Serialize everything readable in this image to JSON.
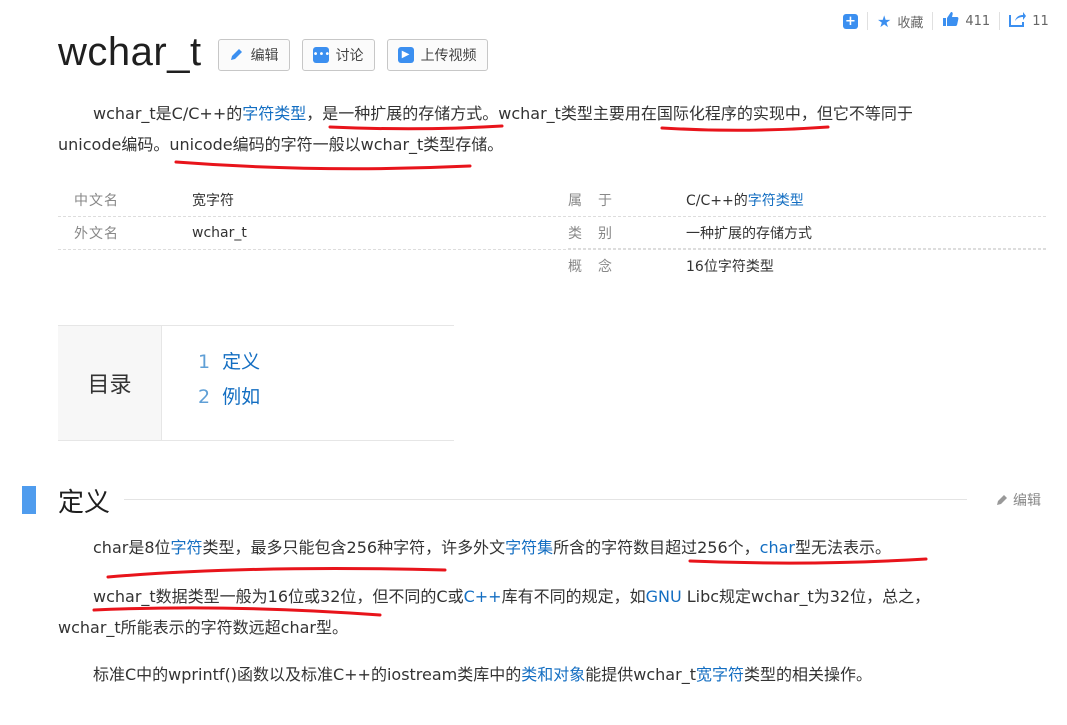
{
  "toolbar": {
    "favorite_label": "收藏",
    "like_count": "411",
    "share_count_partial": "11"
  },
  "title": "wchar_t",
  "buttons": {
    "edit": "编辑",
    "discuss": "讨论",
    "upload_video": "上传视频"
  },
  "summary": {
    "t1": "wchar_t是C/C++的",
    "link1": "字符类型",
    "t2": "，是一种扩展的存储方式。wchar_t类型主要用在国际化程序的实现中，但它不等同于",
    "line2": "unicode编码。unicode编码的字符一般以wchar_t类型存储。"
  },
  "info": {
    "left": [
      {
        "label": "中文名",
        "value": "宽字符"
      },
      {
        "label": "外文名",
        "value": "wchar_t"
      }
    ],
    "right": [
      {
        "label": "属　于",
        "value_prefix": "C/C++的",
        "value_link": "字符类型"
      },
      {
        "label": "类　别",
        "value": "一种扩展的存储方式"
      },
      {
        "label": "概　念",
        "value": "16位字符类型"
      }
    ]
  },
  "catalog": {
    "title": "目录",
    "items": [
      {
        "num": "1",
        "label": "定义"
      },
      {
        "num": "2",
        "label": "例如"
      }
    ]
  },
  "section": {
    "title": "定义",
    "edit_label": "编辑"
  },
  "body": {
    "p1": {
      "t1": "char是8位",
      "l1": "字符",
      "t2": "类型，最多只能包含256种字符，许多外文",
      "l2": "字符集",
      "t3": "所含的字符数目超过256个，",
      "l3": "char",
      "t4": "型无法表示。"
    },
    "p2": {
      "t1": "wchar_t数据类型一般为16位或32位，但不同的C或",
      "l1": "C++",
      "t2": "库有不同的规定，如",
      "l2": "GNU",
      "t3": " Libc规定wchar_t为32位，总之，",
      "line2": "wchar_t所能表示的字符数远超char型。"
    },
    "p3": {
      "t1": "标准C中的wprintf()函数以及标准C++的iostream类库中的",
      "l1": "类和对象",
      "t2": "能提供wchar_t",
      "l2": "宽字符",
      "t3": "类型的相关操作。"
    }
  },
  "colors": {
    "link": "#136ec2",
    "accent": "#4f9cee",
    "annotation": "#e8141b"
  },
  "icons": [
    "plus-square-icon",
    "star-icon",
    "thumbs-up-icon",
    "share-icon",
    "pencil-icon",
    "discuss-icon",
    "play-icon"
  ]
}
